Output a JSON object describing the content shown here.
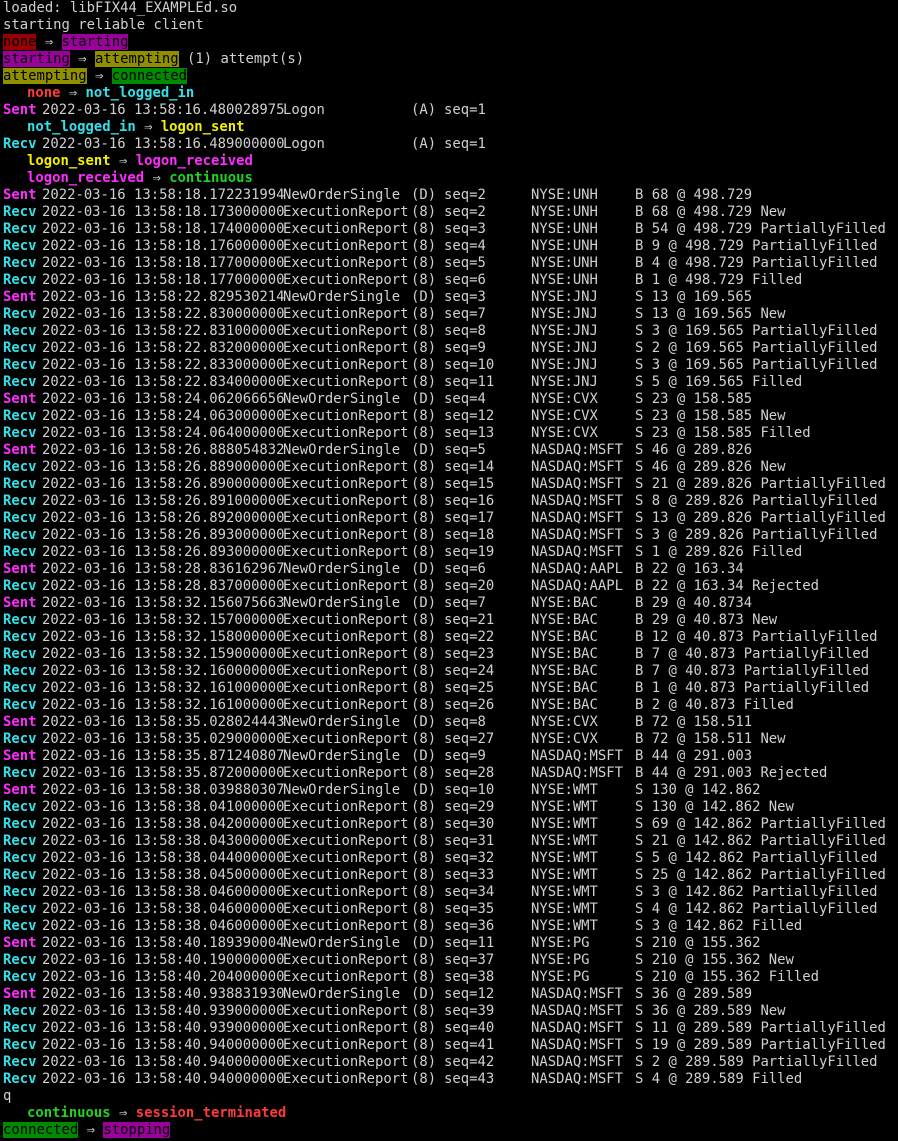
{
  "terminal": {
    "preamble": [
      "loaded: libFIX44_EXAMPLEd.so",
      "starting reliable client"
    ],
    "arrow": " ⇒ ",
    "transitions": [
      {
        "from": "none",
        "to": "starting"
      },
      {
        "from": "starting",
        "to": "attempting",
        "suffix": " (1) attempt(s)"
      },
      {
        "from": "attempting",
        "to": "connected"
      }
    ],
    "session_states": {
      "none_to_not_logged_in": {
        "from": "none",
        "to": "not_logged_in"
      },
      "not_logged_in_to_logon_sent": {
        "from": "not_logged_in",
        "to": "logon_sent"
      },
      "logon_sent_to_logon_received": {
        "from": "logon_sent",
        "to": "logon_received"
      },
      "logon_received_to_continuous": {
        "from": "logon_received",
        "to": "continuous"
      },
      "continuous_to_session_terminated": {
        "from": "continuous",
        "to": "session_terminated"
      }
    },
    "logon_messages": [
      {
        "dir": "Sent",
        "ts": "2022-03-16 13:58:16.480028975",
        "type": "Logon",
        "code": "(A)",
        "seq": "seq=1"
      },
      {
        "dir": "Recv",
        "ts": "2022-03-16 13:58:16.489000000",
        "type": "Logon",
        "code": "(A)",
        "seq": "seq=1"
      }
    ],
    "messages": [
      {
        "dir": "Sent",
        "ts": "2022-03-16 13:58:18.172231994",
        "type": "NewOrderSingle",
        "code": "(D)",
        "seq": "seq=2",
        "sym": "NYSE:UNH",
        "order": "B 68 @ 498.729"
      },
      {
        "dir": "Recv",
        "ts": "2022-03-16 13:58:18.173000000",
        "type": "ExecutionReport",
        "code": "(8)",
        "seq": "seq=2",
        "sym": "NYSE:UNH",
        "order": "B 68 @ 498.729 New"
      },
      {
        "dir": "Recv",
        "ts": "2022-03-16 13:58:18.174000000",
        "type": "ExecutionReport",
        "code": "(8)",
        "seq": "seq=3",
        "sym": "NYSE:UNH",
        "order": "B 54 @ 498.729 PartiallyFilled"
      },
      {
        "dir": "Recv",
        "ts": "2022-03-16 13:58:18.176000000",
        "type": "ExecutionReport",
        "code": "(8)",
        "seq": "seq=4",
        "sym": "NYSE:UNH",
        "order": "B 9 @ 498.729 PartiallyFilled"
      },
      {
        "dir": "Recv",
        "ts": "2022-03-16 13:58:18.177000000",
        "type": "ExecutionReport",
        "code": "(8)",
        "seq": "seq=5",
        "sym": "NYSE:UNH",
        "order": "B 4 @ 498.729 PartiallyFilled"
      },
      {
        "dir": "Recv",
        "ts": "2022-03-16 13:58:18.177000000",
        "type": "ExecutionReport",
        "code": "(8)",
        "seq": "seq=6",
        "sym": "NYSE:UNH",
        "order": "B 1 @ 498.729 Filled"
      },
      {
        "dir": "Sent",
        "ts": "2022-03-16 13:58:22.829530214",
        "type": "NewOrderSingle",
        "code": "(D)",
        "seq": "seq=3",
        "sym": "NYSE:JNJ",
        "order": "S 13 @ 169.565"
      },
      {
        "dir": "Recv",
        "ts": "2022-03-16 13:58:22.830000000",
        "type": "ExecutionReport",
        "code": "(8)",
        "seq": "seq=7",
        "sym": "NYSE:JNJ",
        "order": "S 13 @ 169.565 New"
      },
      {
        "dir": "Recv",
        "ts": "2022-03-16 13:58:22.831000000",
        "type": "ExecutionReport",
        "code": "(8)",
        "seq": "seq=8",
        "sym": "NYSE:JNJ",
        "order": "S 3 @ 169.565 PartiallyFilled"
      },
      {
        "dir": "Recv",
        "ts": "2022-03-16 13:58:22.832000000",
        "type": "ExecutionReport",
        "code": "(8)",
        "seq": "seq=9",
        "sym": "NYSE:JNJ",
        "order": "S 2 @ 169.565 PartiallyFilled"
      },
      {
        "dir": "Recv",
        "ts": "2022-03-16 13:58:22.833000000",
        "type": "ExecutionReport",
        "code": "(8)",
        "seq": "seq=10",
        "sym": "NYSE:JNJ",
        "order": "S 3 @ 169.565 PartiallyFilled"
      },
      {
        "dir": "Recv",
        "ts": "2022-03-16 13:58:22.834000000",
        "type": "ExecutionReport",
        "code": "(8)",
        "seq": "seq=11",
        "sym": "NYSE:JNJ",
        "order": "S 5 @ 169.565 Filled"
      },
      {
        "dir": "Sent",
        "ts": "2022-03-16 13:58:24.062066656",
        "type": "NewOrderSingle",
        "code": "(D)",
        "seq": "seq=4",
        "sym": "NYSE:CVX",
        "order": "S 23 @ 158.585"
      },
      {
        "dir": "Recv",
        "ts": "2022-03-16 13:58:24.063000000",
        "type": "ExecutionReport",
        "code": "(8)",
        "seq": "seq=12",
        "sym": "NYSE:CVX",
        "order": "S 23 @ 158.585 New"
      },
      {
        "dir": "Recv",
        "ts": "2022-03-16 13:58:24.064000000",
        "type": "ExecutionReport",
        "code": "(8)",
        "seq": "seq=13",
        "sym": "NYSE:CVX",
        "order": "S 23 @ 158.585 Filled"
      },
      {
        "dir": "Sent",
        "ts": "2022-03-16 13:58:26.888054832",
        "type": "NewOrderSingle",
        "code": "(D)",
        "seq": "seq=5",
        "sym": "NASDAQ:MSFT",
        "order": "S 46 @ 289.826"
      },
      {
        "dir": "Recv",
        "ts": "2022-03-16 13:58:26.889000000",
        "type": "ExecutionReport",
        "code": "(8)",
        "seq": "seq=14",
        "sym": "NASDAQ:MSFT",
        "order": "S 46 @ 289.826 New"
      },
      {
        "dir": "Recv",
        "ts": "2022-03-16 13:58:26.890000000",
        "type": "ExecutionReport",
        "code": "(8)",
        "seq": "seq=15",
        "sym": "NASDAQ:MSFT",
        "order": "S 21 @ 289.826 PartiallyFilled"
      },
      {
        "dir": "Recv",
        "ts": "2022-03-16 13:58:26.891000000",
        "type": "ExecutionReport",
        "code": "(8)",
        "seq": "seq=16",
        "sym": "NASDAQ:MSFT",
        "order": "S 8 @ 289.826 PartiallyFilled"
      },
      {
        "dir": "Recv",
        "ts": "2022-03-16 13:58:26.892000000",
        "type": "ExecutionReport",
        "code": "(8)",
        "seq": "seq=17",
        "sym": "NASDAQ:MSFT",
        "order": "S 13 @ 289.826 PartiallyFilled"
      },
      {
        "dir": "Recv",
        "ts": "2022-03-16 13:58:26.893000000",
        "type": "ExecutionReport",
        "code": "(8)",
        "seq": "seq=18",
        "sym": "NASDAQ:MSFT",
        "order": "S 3 @ 289.826 PartiallyFilled"
      },
      {
        "dir": "Recv",
        "ts": "2022-03-16 13:58:26.893000000",
        "type": "ExecutionReport",
        "code": "(8)",
        "seq": "seq=19",
        "sym": "NASDAQ:MSFT",
        "order": "S 1 @ 289.826 Filled"
      },
      {
        "dir": "Sent",
        "ts": "2022-03-16 13:58:28.836162967",
        "type": "NewOrderSingle",
        "code": "(D)",
        "seq": "seq=6",
        "sym": "NASDAQ:AAPL",
        "order": "B 22 @ 163.34"
      },
      {
        "dir": "Recv",
        "ts": "2022-03-16 13:58:28.837000000",
        "type": "ExecutionReport",
        "code": "(8)",
        "seq": "seq=20",
        "sym": "NASDAQ:AAPL",
        "order": "B 22 @ 163.34 Rejected"
      },
      {
        "dir": "Sent",
        "ts": "2022-03-16 13:58:32.156075663",
        "type": "NewOrderSingle",
        "code": "(D)",
        "seq": "seq=7",
        "sym": "NYSE:BAC",
        "order": "B 29 @ 40.8734"
      },
      {
        "dir": "Recv",
        "ts": "2022-03-16 13:58:32.157000000",
        "type": "ExecutionReport",
        "code": "(8)",
        "seq": "seq=21",
        "sym": "NYSE:BAC",
        "order": "B 29 @ 40.873 New"
      },
      {
        "dir": "Recv",
        "ts": "2022-03-16 13:58:32.158000000",
        "type": "ExecutionReport",
        "code": "(8)",
        "seq": "seq=22",
        "sym": "NYSE:BAC",
        "order": "B 12 @ 40.873 PartiallyFilled"
      },
      {
        "dir": "Recv",
        "ts": "2022-03-16 13:58:32.159000000",
        "type": "ExecutionReport",
        "code": "(8)",
        "seq": "seq=23",
        "sym": "NYSE:BAC",
        "order": "B 7 @ 40.873 PartiallyFilled"
      },
      {
        "dir": "Recv",
        "ts": "2022-03-16 13:58:32.160000000",
        "type": "ExecutionReport",
        "code": "(8)",
        "seq": "seq=24",
        "sym": "NYSE:BAC",
        "order": "B 7 @ 40.873 PartiallyFilled"
      },
      {
        "dir": "Recv",
        "ts": "2022-03-16 13:58:32.161000000",
        "type": "ExecutionReport",
        "code": "(8)",
        "seq": "seq=25",
        "sym": "NYSE:BAC",
        "order": "B 1 @ 40.873 PartiallyFilled"
      },
      {
        "dir": "Recv",
        "ts": "2022-03-16 13:58:32.161000000",
        "type": "ExecutionReport",
        "code": "(8)",
        "seq": "seq=26",
        "sym": "NYSE:BAC",
        "order": "B 2 @ 40.873 Filled"
      },
      {
        "dir": "Sent",
        "ts": "2022-03-16 13:58:35.028024443",
        "type": "NewOrderSingle",
        "code": "(D)",
        "seq": "seq=8",
        "sym": "NYSE:CVX",
        "order": "B 72 @ 158.511"
      },
      {
        "dir": "Recv",
        "ts": "2022-03-16 13:58:35.029000000",
        "type": "ExecutionReport",
        "code": "(8)",
        "seq": "seq=27",
        "sym": "NYSE:CVX",
        "order": "B 72 @ 158.511 New"
      },
      {
        "dir": "Sent",
        "ts": "2022-03-16 13:58:35.871240807",
        "type": "NewOrderSingle",
        "code": "(D)",
        "seq": "seq=9",
        "sym": "NASDAQ:MSFT",
        "order": "B 44 @ 291.003"
      },
      {
        "dir": "Recv",
        "ts": "2022-03-16 13:58:35.872000000",
        "type": "ExecutionReport",
        "code": "(8)",
        "seq": "seq=28",
        "sym": "NASDAQ:MSFT",
        "order": "B 44 @ 291.003 Rejected"
      },
      {
        "dir": "Sent",
        "ts": "2022-03-16 13:58:38.039880307",
        "type": "NewOrderSingle",
        "code": "(D)",
        "seq": "seq=10",
        "sym": "NYSE:WMT",
        "order": "S 130 @ 142.862"
      },
      {
        "dir": "Recv",
        "ts": "2022-03-16 13:58:38.041000000",
        "type": "ExecutionReport",
        "code": "(8)",
        "seq": "seq=29",
        "sym": "NYSE:WMT",
        "order": "S 130 @ 142.862 New"
      },
      {
        "dir": "Recv",
        "ts": "2022-03-16 13:58:38.042000000",
        "type": "ExecutionReport",
        "code": "(8)",
        "seq": "seq=30",
        "sym": "NYSE:WMT",
        "order": "S 69 @ 142.862 PartiallyFilled"
      },
      {
        "dir": "Recv",
        "ts": "2022-03-16 13:58:38.043000000",
        "type": "ExecutionReport",
        "code": "(8)",
        "seq": "seq=31",
        "sym": "NYSE:WMT",
        "order": "S 21 @ 142.862 PartiallyFilled"
      },
      {
        "dir": "Recv",
        "ts": "2022-03-16 13:58:38.044000000",
        "type": "ExecutionReport",
        "code": "(8)",
        "seq": "seq=32",
        "sym": "NYSE:WMT",
        "order": "S 5 @ 142.862 PartiallyFilled"
      },
      {
        "dir": "Recv",
        "ts": "2022-03-16 13:58:38.045000000",
        "type": "ExecutionReport",
        "code": "(8)",
        "seq": "seq=33",
        "sym": "NYSE:WMT",
        "order": "S 25 @ 142.862 PartiallyFilled"
      },
      {
        "dir": "Recv",
        "ts": "2022-03-16 13:58:38.046000000",
        "type": "ExecutionReport",
        "code": "(8)",
        "seq": "seq=34",
        "sym": "NYSE:WMT",
        "order": "S 3 @ 142.862 PartiallyFilled"
      },
      {
        "dir": "Recv",
        "ts": "2022-03-16 13:58:38.046000000",
        "type": "ExecutionReport",
        "code": "(8)",
        "seq": "seq=35",
        "sym": "NYSE:WMT",
        "order": "S 4 @ 142.862 PartiallyFilled"
      },
      {
        "dir": "Recv",
        "ts": "2022-03-16 13:58:38.046000000",
        "type": "ExecutionReport",
        "code": "(8)",
        "seq": "seq=36",
        "sym": "NYSE:WMT",
        "order": "S 3 @ 142.862 Filled"
      },
      {
        "dir": "Sent",
        "ts": "2022-03-16 13:58:40.189390004",
        "type": "NewOrderSingle",
        "code": "(D)",
        "seq": "seq=11",
        "sym": "NYSE:PG",
        "order": "S 210 @ 155.362"
      },
      {
        "dir": "Recv",
        "ts": "2022-03-16 13:58:40.190000000",
        "type": "ExecutionReport",
        "code": "(8)",
        "seq": "seq=37",
        "sym": "NYSE:PG",
        "order": "S 210 @ 155.362 New"
      },
      {
        "dir": "Recv",
        "ts": "2022-03-16 13:58:40.204000000",
        "type": "ExecutionReport",
        "code": "(8)",
        "seq": "seq=38",
        "sym": "NYSE:PG",
        "order": "S 210 @ 155.362 Filled"
      },
      {
        "dir": "Sent",
        "ts": "2022-03-16 13:58:40.938831930",
        "type": "NewOrderSingle",
        "code": "(D)",
        "seq": "seq=12",
        "sym": "NASDAQ:MSFT",
        "order": "S 36 @ 289.589"
      },
      {
        "dir": "Recv",
        "ts": "2022-03-16 13:58:40.939000000",
        "type": "ExecutionReport",
        "code": "(8)",
        "seq": "seq=39",
        "sym": "NASDAQ:MSFT",
        "order": "S 36 @ 289.589 New"
      },
      {
        "dir": "Recv",
        "ts": "2022-03-16 13:58:40.939000000",
        "type": "ExecutionReport",
        "code": "(8)",
        "seq": "seq=40",
        "sym": "NASDAQ:MSFT",
        "order": "S 11 @ 289.589 PartiallyFilled"
      },
      {
        "dir": "Recv",
        "ts": "2022-03-16 13:58:40.940000000",
        "type": "ExecutionReport",
        "code": "(8)",
        "seq": "seq=41",
        "sym": "NASDAQ:MSFT",
        "order": "S 19 @ 289.589 PartiallyFilled"
      },
      {
        "dir": "Recv",
        "ts": "2022-03-16 13:58:40.940000000",
        "type": "ExecutionReport",
        "code": "(8)",
        "seq": "seq=42",
        "sym": "NASDAQ:MSFT",
        "order": "S 2 @ 289.589 PartiallyFilled"
      },
      {
        "dir": "Recv",
        "ts": "2022-03-16 13:58:40.940000000",
        "type": "ExecutionReport",
        "code": "(8)",
        "seq": "seq=43",
        "sym": "NASDAQ:MSFT",
        "order": "S 4 @ 289.589 Filled"
      }
    ],
    "input_line": "q",
    "final_transition": {
      "from": "connected",
      "to": "stopping"
    },
    "colors": {
      "background": "#000000",
      "text": "#d0d0d0",
      "sent": "#ff2cff",
      "recv": "#33e0e8",
      "state_none_bg": "#9b0000",
      "state_starting_bg": "#9a009a",
      "state_attempting_bg": "#8f8f00",
      "state_connected_bg": "#008a00",
      "session_continuous": "#1fd31f",
      "session_terminated": "#ff3a3a"
    }
  }
}
